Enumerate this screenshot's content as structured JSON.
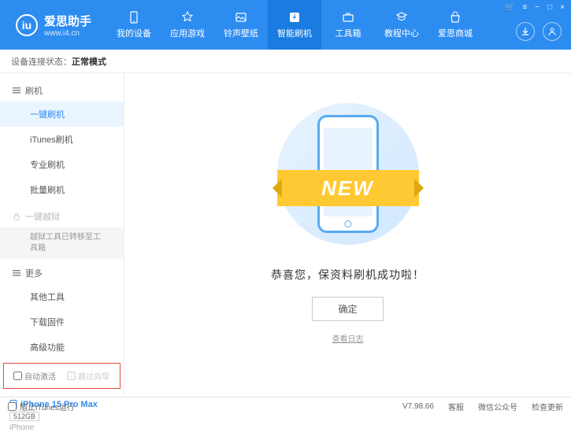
{
  "header": {
    "logo_title": "爱思助手",
    "logo_url": "www.i4.cn",
    "nav": [
      {
        "label": "我的设备"
      },
      {
        "label": "应用游戏"
      },
      {
        "label": "铃声壁纸"
      },
      {
        "label": "智能刷机",
        "active": true
      },
      {
        "label": "工具箱"
      },
      {
        "label": "教程中心"
      },
      {
        "label": "爱思商城"
      }
    ],
    "window_controls": {
      "cart": "🛒",
      "menu": "≡",
      "min": "−",
      "max": "□",
      "close": "×"
    }
  },
  "status": {
    "label": "设备连接状态：",
    "mode": "正常模式"
  },
  "sidebar": {
    "flash": {
      "header": "刷机",
      "items": [
        "一键刷机",
        "iTunes刷机",
        "专业刷机",
        "批量刷机"
      ]
    },
    "jailbreak": {
      "header": "一键越狱",
      "note": "越狱工具已转移至工具箱"
    },
    "more": {
      "header": "更多",
      "items": [
        "其他工具",
        "下载固件",
        "高级功能"
      ]
    },
    "checkbox1": "自动激活",
    "checkbox2": "跳过向导",
    "device": {
      "name": "iPhone 15 Pro Max",
      "storage": "512GB",
      "type": "iPhone"
    }
  },
  "main": {
    "ribbon": "NEW",
    "success": "恭喜您，保资料刷机成功啦！",
    "ok": "确定",
    "viewlog": "查看日志"
  },
  "footer": {
    "block_itunes": "阻止iTunes运行",
    "version": "V7.98.66",
    "support": "客服",
    "wechat": "微信公众号",
    "update": "检查更新"
  }
}
